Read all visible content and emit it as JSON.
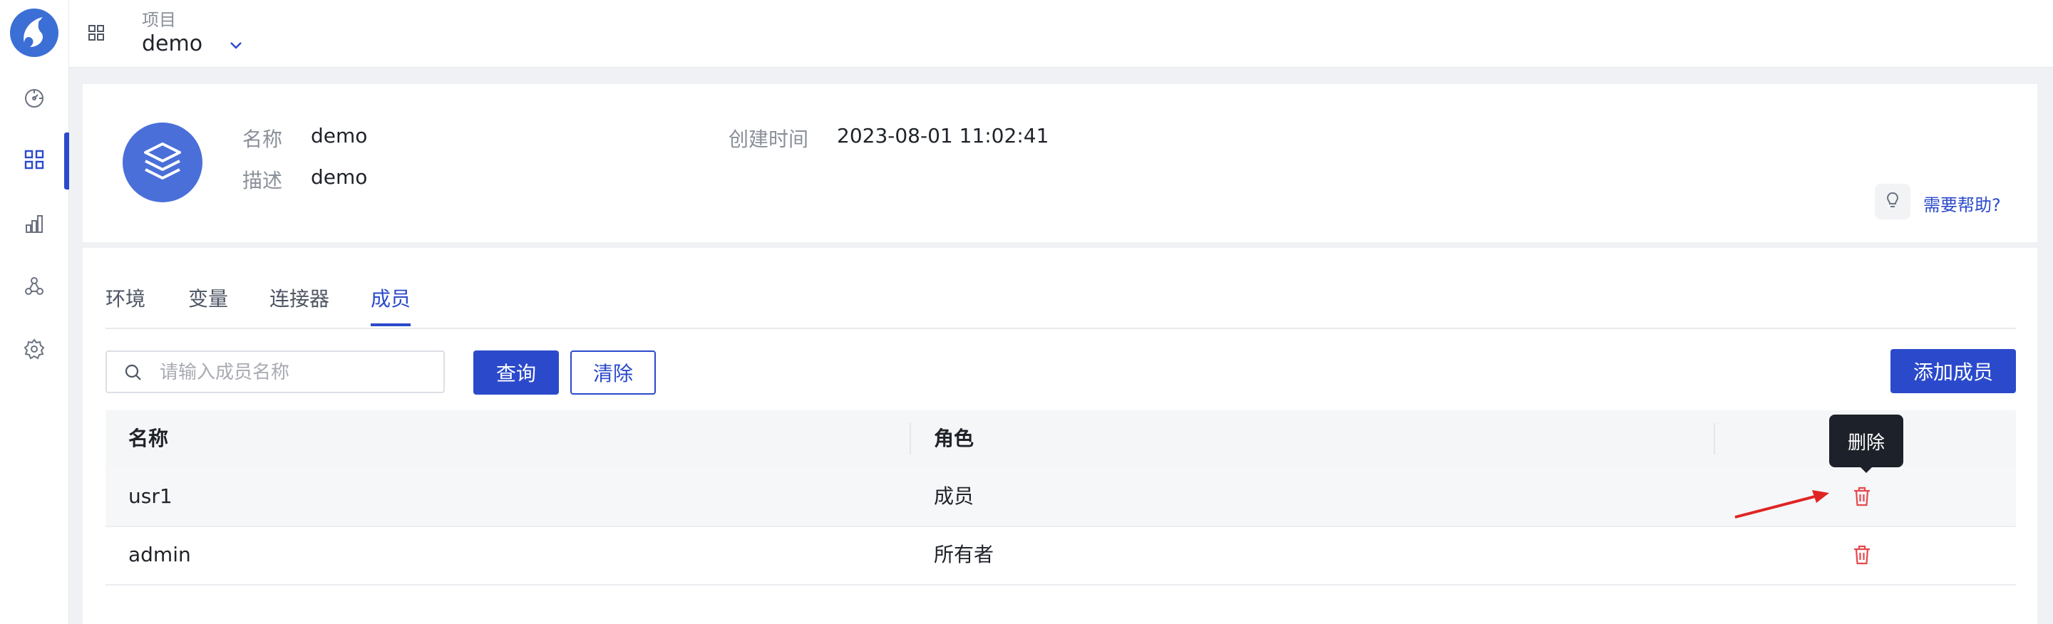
{
  "topbar": {
    "project_label": "项目",
    "project_name": "demo",
    "icons": [
      "apps-grid-icon",
      "chevron-down-icon"
    ]
  },
  "sidebar": {
    "items": [
      {
        "name": "dashboard",
        "icon": "palette-icon",
        "active": false
      },
      {
        "name": "projects",
        "icon": "apps-grid-icon",
        "active": true
      },
      {
        "name": "analytics",
        "icon": "bar-chart-icon",
        "active": false
      },
      {
        "name": "connectors",
        "icon": "nodes-icon",
        "active": false
      },
      {
        "name": "settings",
        "icon": "gear-icon",
        "active": false
      }
    ]
  },
  "project_info": {
    "name_label": "名称",
    "name_value": "demo",
    "desc_label": "描述",
    "desc_value": "demo",
    "created_label": "创建时间",
    "created_value": "2023-08-01 11:02:41",
    "help_text": "需要帮助?",
    "avatar_icon": "layers-icon"
  },
  "tabs": [
    {
      "label": "环境",
      "active": false
    },
    {
      "label": "变量",
      "active": false
    },
    {
      "label": "连接器",
      "active": false
    },
    {
      "label": "成员",
      "active": true
    }
  ],
  "toolbar": {
    "search_placeholder": "请输入成员名称",
    "search_value": "",
    "query_label": "查询",
    "clear_label": "清除",
    "add_label": "添加成员"
  },
  "table": {
    "headers": [
      "名称",
      "角色",
      ""
    ],
    "rows": [
      {
        "name": "usr1",
        "role": "成员"
      },
      {
        "name": "admin",
        "role": "所有者"
      }
    ]
  },
  "tooltip": {
    "text": "删除"
  },
  "colors": {
    "primary": "#2b4acb",
    "danger": "#e5484d",
    "annotation_arrow": "#e02424",
    "avatar_bg": "#4a6fd8"
  }
}
